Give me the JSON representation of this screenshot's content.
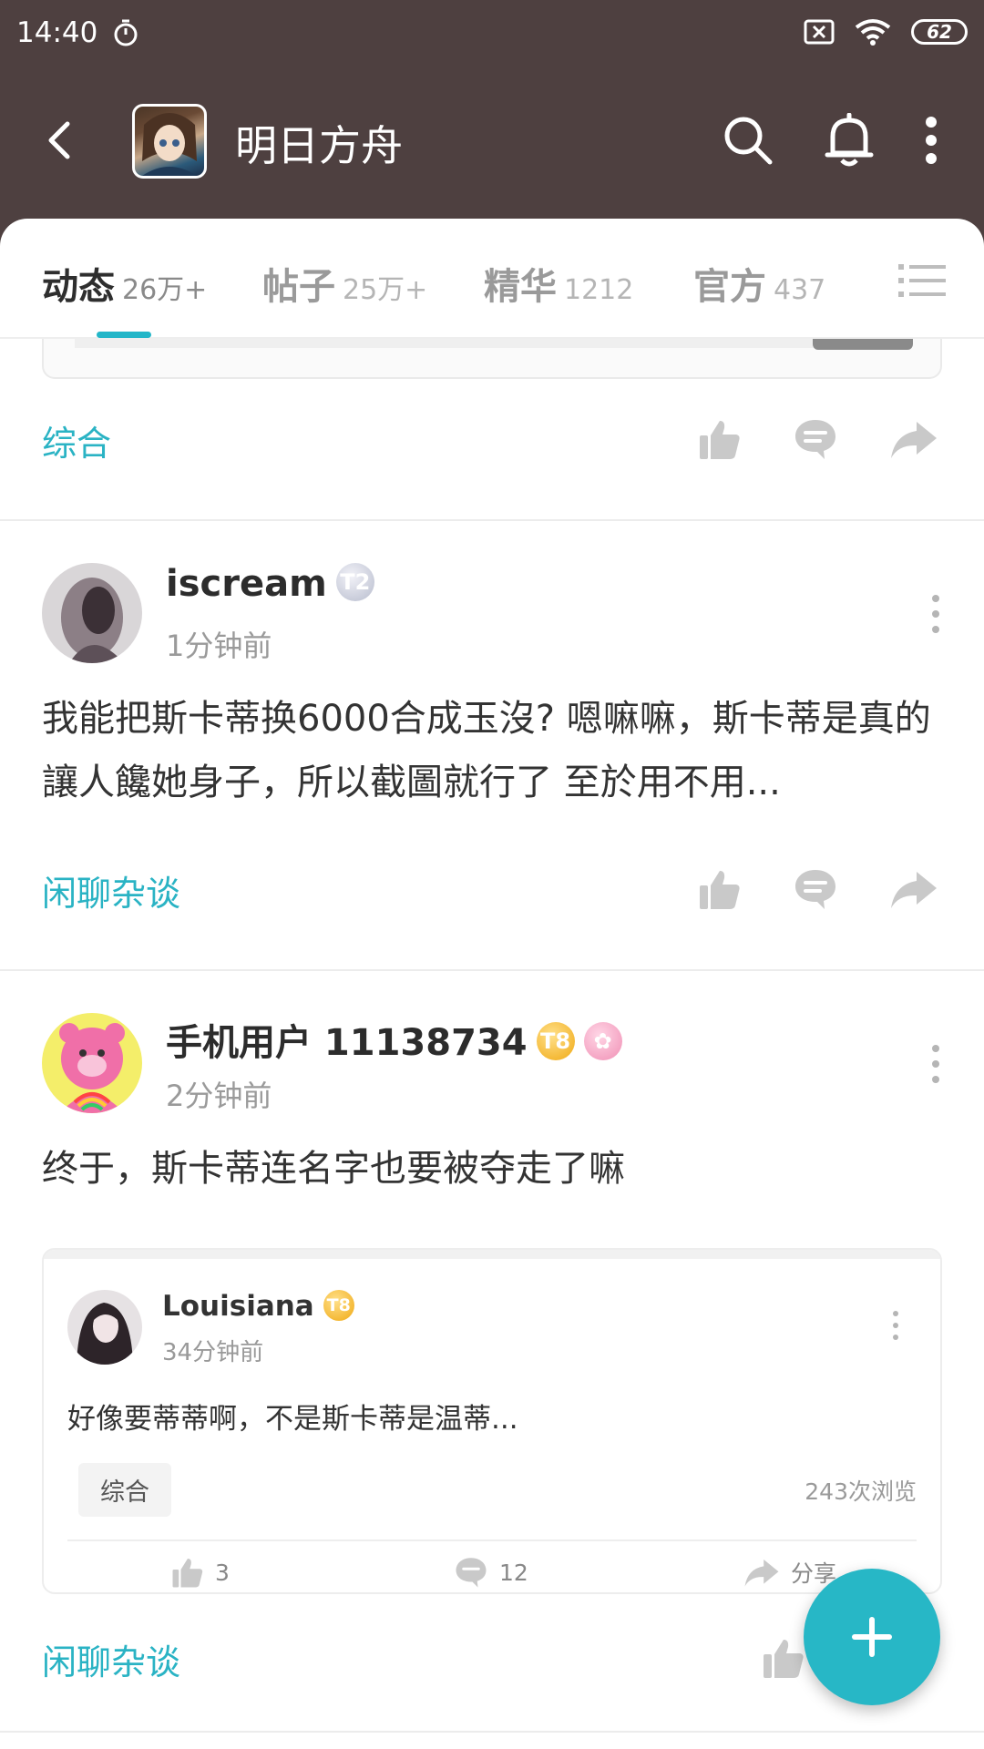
{
  "status_bar": {
    "time": "14:40",
    "battery": "62"
  },
  "app_bar": {
    "title": "明日方舟"
  },
  "tabs": [
    {
      "label": "动态",
      "count": "26万+"
    },
    {
      "label": "帖子",
      "count": "25万+"
    },
    {
      "label": "精华",
      "count": "1212"
    },
    {
      "label": "官方",
      "count": "437"
    }
  ],
  "feed": {
    "first_tag": "综合",
    "posts": [
      {
        "username": "iscream",
        "badge": "T2",
        "time": "1分钟前",
        "text": "我能把斯卡蒂换6000合成玉沒? 嗯嘛嘛，斯卡蒂是真的讓人饞她身子，所以截圖就行了 至於用不用...",
        "tag": "闲聊杂谈"
      },
      {
        "username": "手机用户 11138734",
        "badge": "T8",
        "time": "2分钟前",
        "text": "终于，斯卡蒂连名字也要被夺走了嘛",
        "tag": "闲聊杂谈",
        "quote": {
          "username": "Louisiana",
          "badge": "T8",
          "time": "34分钟前",
          "text": "好像要蒂蒂啊，不是斯卡蒂是温蒂...",
          "tag": "综合",
          "views": "243次浏览",
          "likes": "3",
          "comments": "12",
          "share": "分享"
        }
      }
    ]
  },
  "colors": {
    "header_bg": "#4e4040",
    "accent": "#27b7c6"
  },
  "icons": {
    "back": "back-arrow-icon",
    "search": "search-icon",
    "bell": "bell-icon",
    "more": "more-vertical-icon",
    "like": "thumbs-up-icon",
    "comment": "comment-icon",
    "share": "share-icon",
    "add": "plus-icon"
  }
}
